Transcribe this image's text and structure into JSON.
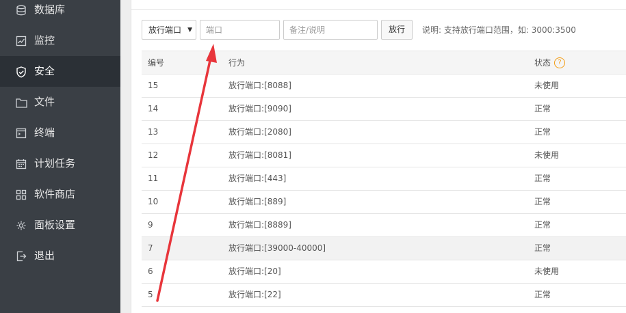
{
  "sidebar": {
    "items": [
      {
        "label": "数据库",
        "icon": "database-icon"
      },
      {
        "label": "监控",
        "icon": "monitor-icon"
      },
      {
        "label": "安全",
        "icon": "shield-icon",
        "active": true
      },
      {
        "label": "文件",
        "icon": "folder-icon"
      },
      {
        "label": "终端",
        "icon": "terminal-icon"
      },
      {
        "label": "计划任务",
        "icon": "calendar-icon"
      },
      {
        "label": "软件商店",
        "icon": "grid-icon"
      },
      {
        "label": "面板设置",
        "icon": "gear-icon"
      },
      {
        "label": "退出",
        "icon": "logout-icon"
      }
    ]
  },
  "toolbar": {
    "select_value": "放行端口",
    "port_placeholder": "端口",
    "remark_placeholder": "备注/说明",
    "allow_label": "放行",
    "hint": "说明: 支持放行端口范围，如: 3000:3500"
  },
  "table": {
    "headers": [
      "编号",
      "行为",
      "状态"
    ],
    "rows": [
      {
        "id": "15",
        "action": "放行端口:[8088]",
        "status": "未使用"
      },
      {
        "id": "14",
        "action": "放行端口:[9090]",
        "status": "正常"
      },
      {
        "id": "13",
        "action": "放行端口:[2080]",
        "status": "正常"
      },
      {
        "id": "12",
        "action": "放行端口:[8081]",
        "status": "未使用"
      },
      {
        "id": "11",
        "action": "放行端口:[443]",
        "status": "正常"
      },
      {
        "id": "10",
        "action": "放行端口:[889]",
        "status": "正常"
      },
      {
        "id": "9",
        "action": "放行端口:[8889]",
        "status": "正常"
      },
      {
        "id": "7",
        "action": "放行端口:[39000-40000]",
        "status": "正常"
      },
      {
        "id": "6",
        "action": "放行端口:[20]",
        "status": "未使用"
      },
      {
        "id": "5",
        "action": "放行端口:[22]",
        "status": "正常"
      }
    ]
  },
  "help_icon_text": "?",
  "colors": {
    "sidebar": "#3a3f45",
    "sidebar_active": "#2b3036",
    "annotation_arrow": "#e8353b",
    "help": "#f39c12"
  }
}
